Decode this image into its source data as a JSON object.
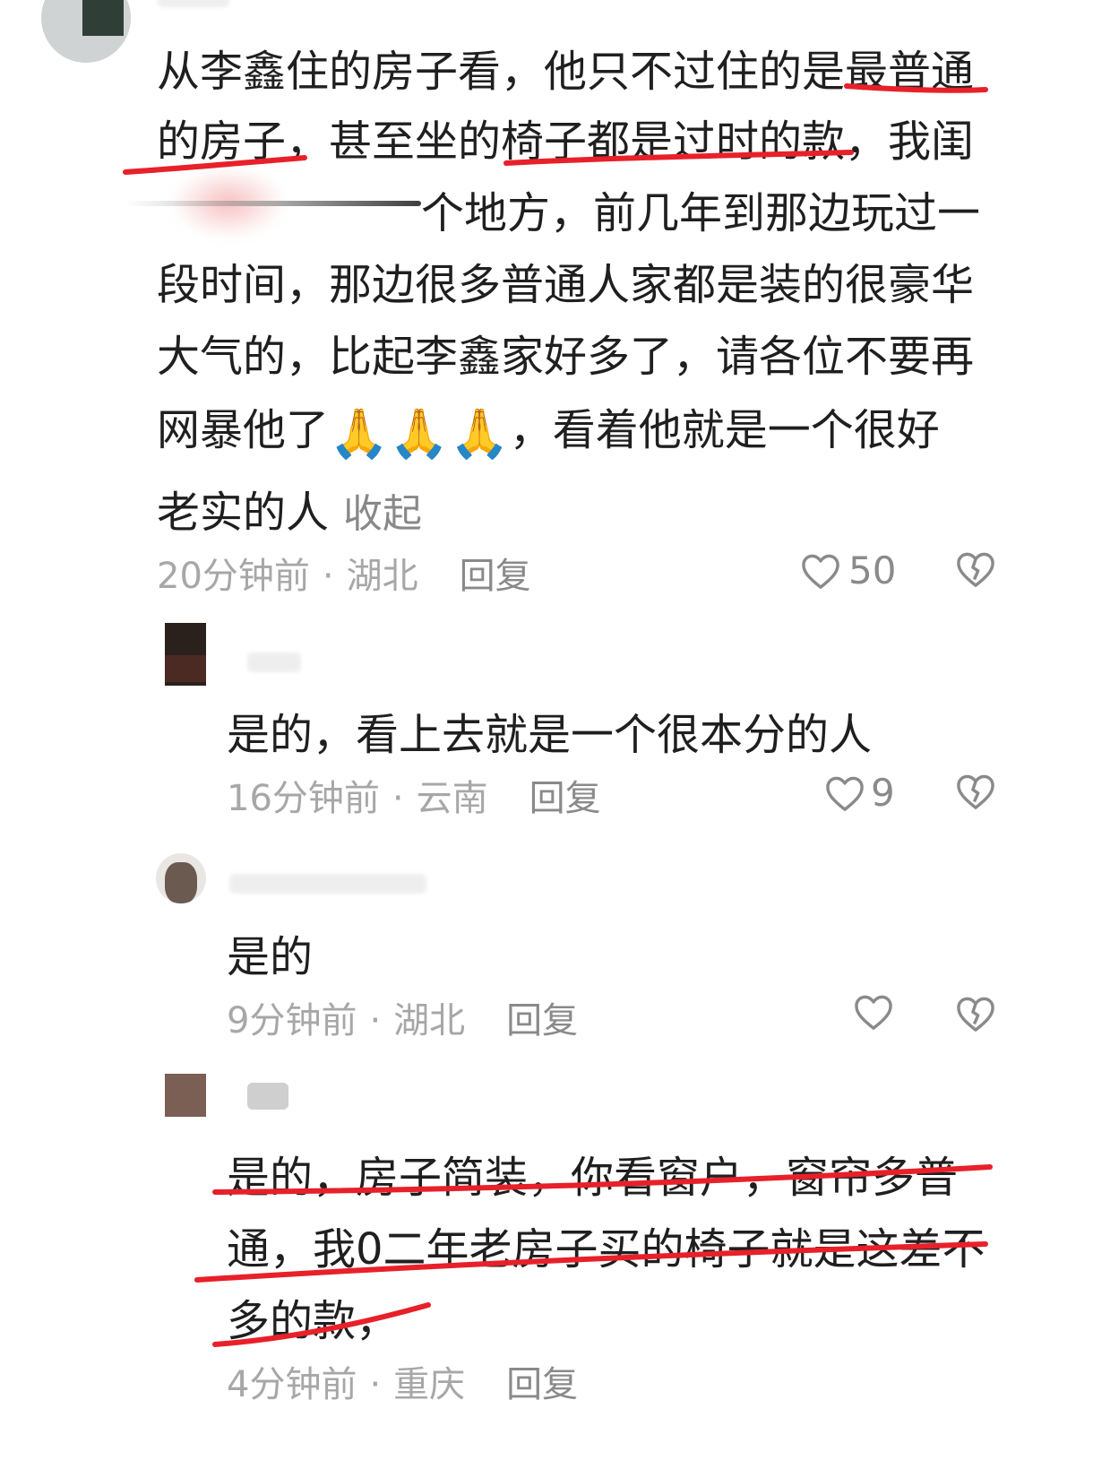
{
  "comments": [
    {
      "lines": [
        "从李鑫住的房子看，他只不过住的是最普通",
        "的房子，甚至坐的椅子都是过时的款，我闺",
        "个地方，前几年到那边玩过一",
        "段时间，那边很多普通人家都是装的很豪华",
        "大气的，比起李鑫家好多了，请各位不要再",
        "网暴他了",
        "，看着他就是一个很好",
        "老实的人"
      ],
      "collapse_label": "收起",
      "emoji": "🙏",
      "time": "20分钟前",
      "location": "湖北",
      "reply_label": "回复",
      "likes": "50"
    },
    {
      "lines": [
        "是的，看上去就是一个很本分的人"
      ],
      "time": "16分钟前",
      "location": "云南",
      "reply_label": "回复",
      "likes": "9"
    },
    {
      "lines": [
        "是的"
      ],
      "time": "9分钟前",
      "location": "湖北",
      "reply_label": "回复",
      "likes": ""
    },
    {
      "lines": [
        "是的，房子简装，你看窗户，窗帘多普",
        "通，我0二年老房子买的椅子就是这差不",
        "多的款，"
      ],
      "time": "4分钟前",
      "location": "重庆",
      "reply_label": "回复"
    }
  ],
  "meta_separator": "·",
  "colors": {
    "annotation_red": "#e8202a",
    "meta_gray": "#a7a7a7",
    "icon_gray": "#8a8a8a"
  },
  "icons": [
    "heart-outline-icon",
    "broken-heart-icon",
    "folded-hands-emoji"
  ]
}
